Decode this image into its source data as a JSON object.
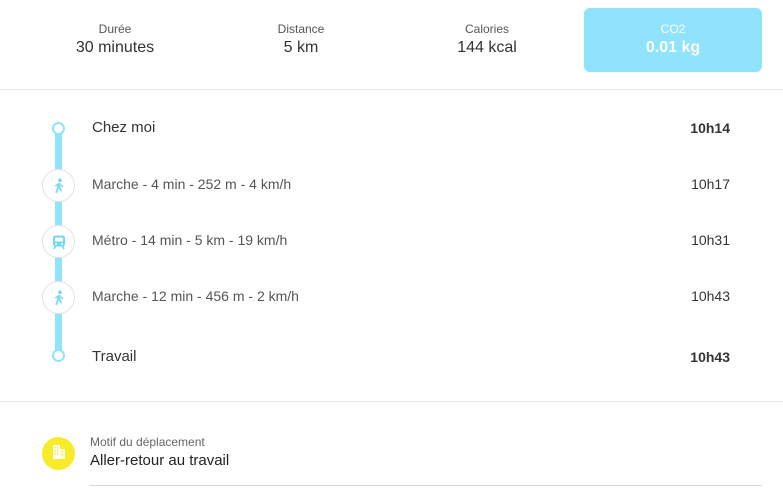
{
  "stats": {
    "duree": {
      "label": "Durée",
      "value": "30 minutes"
    },
    "distance": {
      "label": "Distance",
      "value": "5 km"
    },
    "calories": {
      "label": "Calories",
      "value": "144 kcal"
    },
    "co2": {
      "label": "CO2",
      "value": "0.01 kg"
    }
  },
  "timeline": {
    "start": {
      "label": "Chez moi",
      "time": "10h14"
    },
    "steps": [
      {
        "icon": "walking-icon",
        "text": "Marche - 4 min - 252 m - 4 km/h",
        "time": "10h17"
      },
      {
        "icon": "metro-icon",
        "text": "Métro - 14 min - 5 km - 19 km/h",
        "time": "10h31"
      },
      {
        "icon": "walking-icon",
        "text": "Marche - 12 min - 456 m - 2 km/h",
        "time": "10h43"
      }
    ],
    "end": {
      "label": "Travail",
      "time": "10h43"
    }
  },
  "motif": {
    "icon": "building-icon",
    "label": "Motif du déplacement",
    "value": "Aller-retour au travail"
  },
  "colors": {
    "accent": "#8fe3fc",
    "motif_icon_bg": "#f7ec2a"
  }
}
